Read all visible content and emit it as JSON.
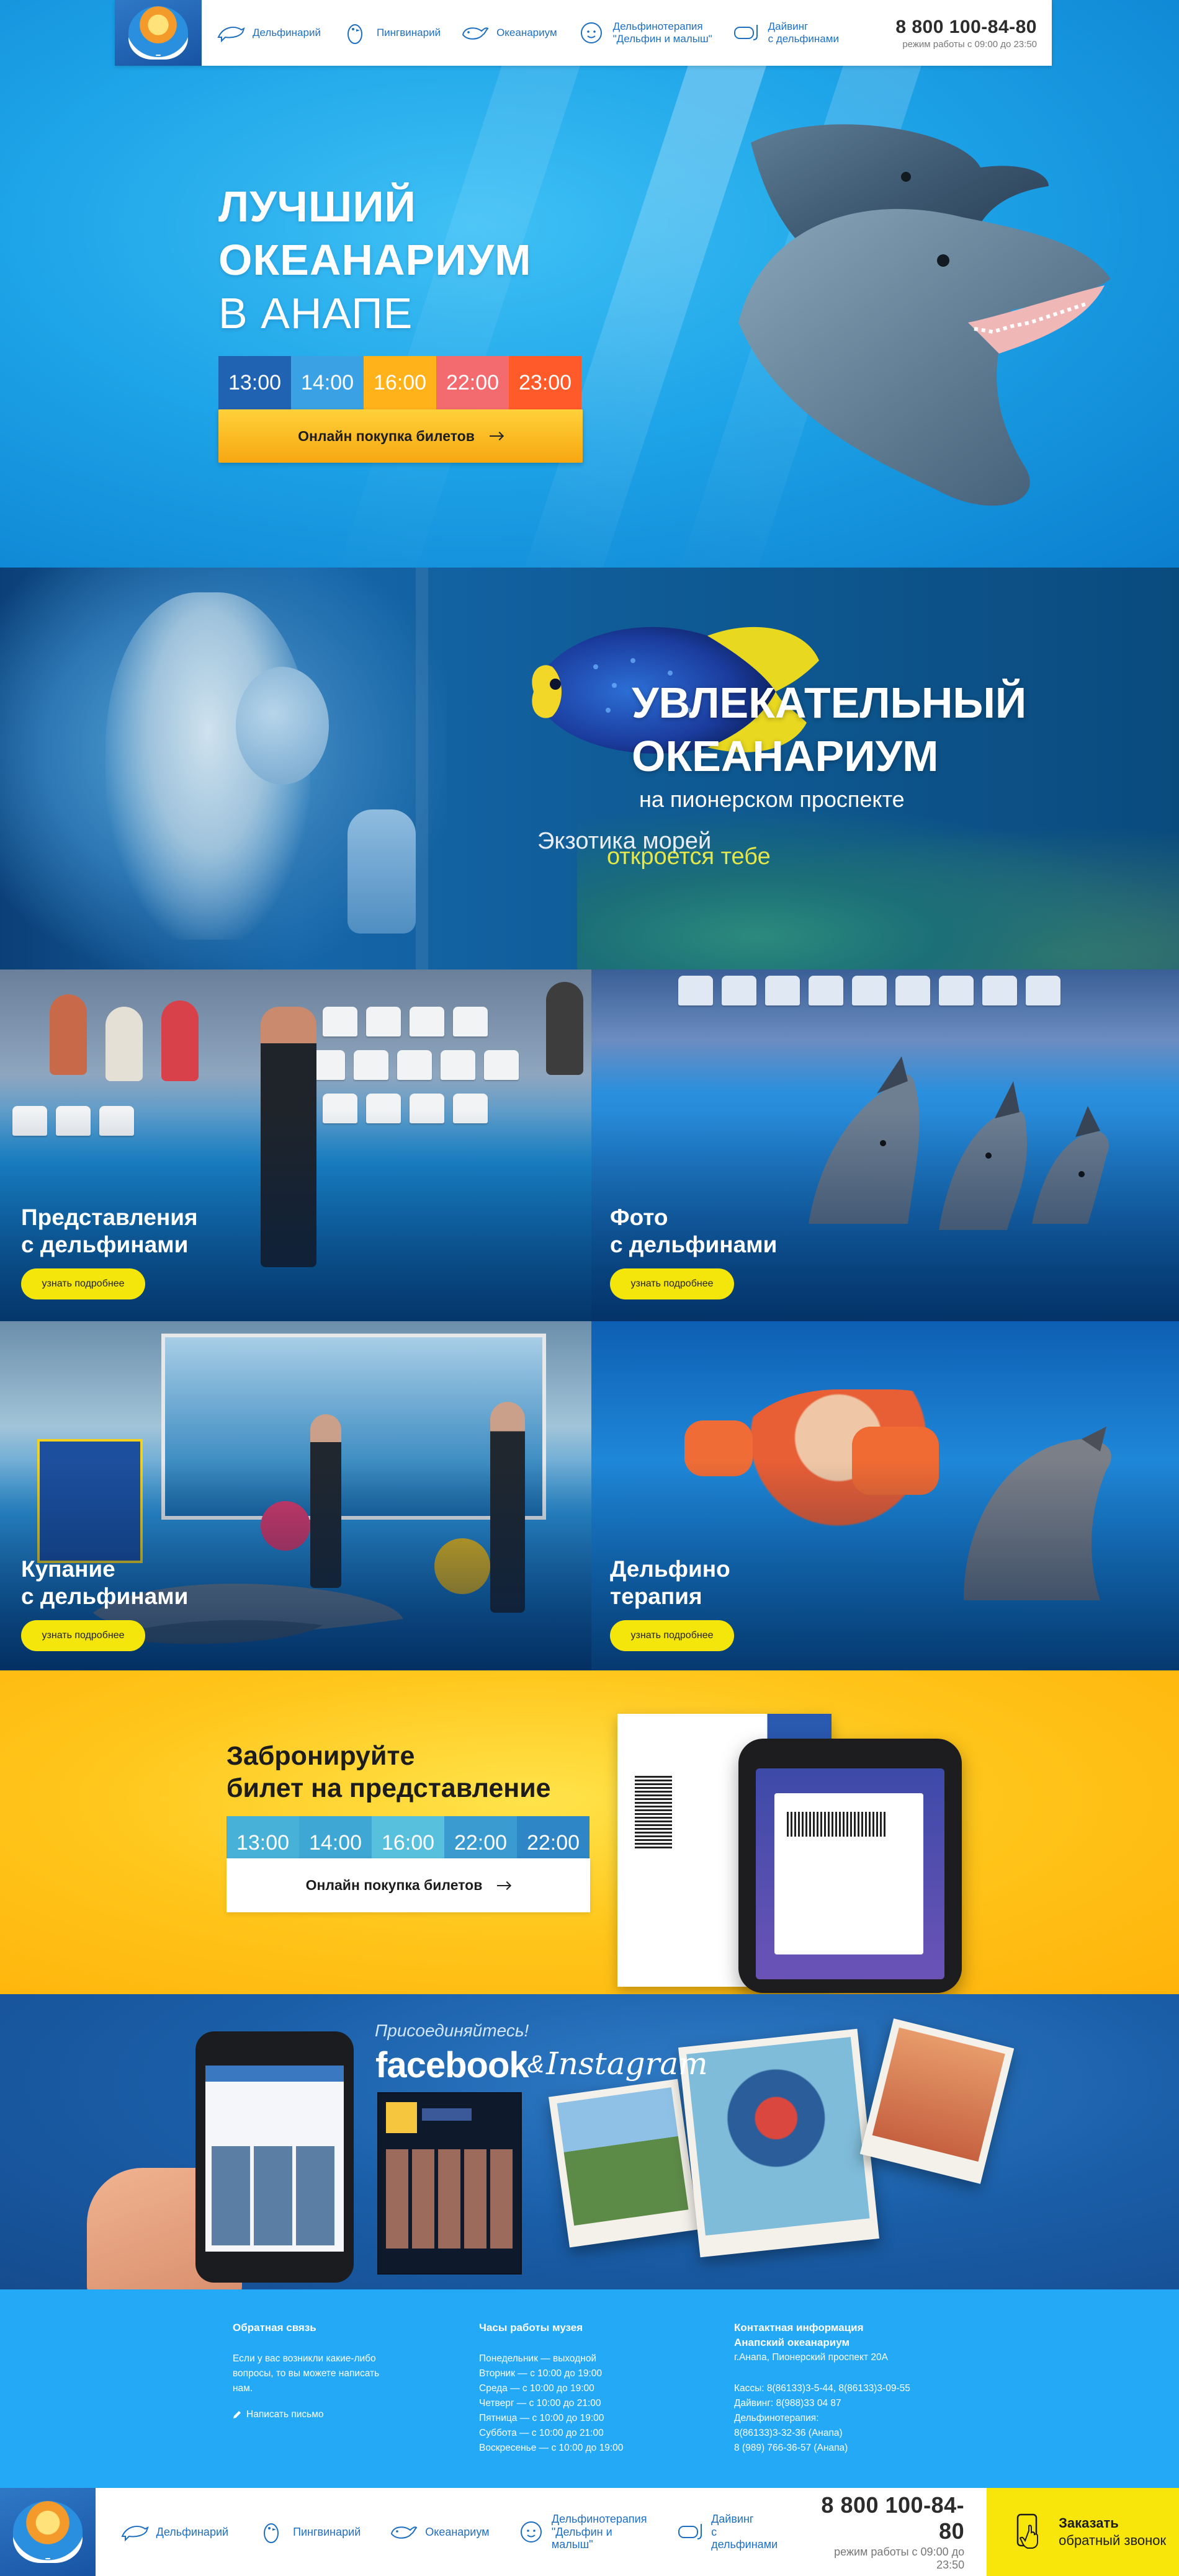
{
  "header": {
    "nav": [
      {
        "label": "Дельфинарий",
        "icon": "dolphin-icon"
      },
      {
        "label": "Пингвинарий",
        "icon": "penguin-icon"
      },
      {
        "label": "Океанариум",
        "icon": "whale-icon"
      },
      {
        "label": "Дельфинотерапия\n\"Дельфин и малыш\"",
        "icon": "baby-icon"
      },
      {
        "label": "Дайвинг\nс дельфинами",
        "icon": "diving-mask-icon"
      }
    ],
    "phone": "8 800 100-84-80",
    "hours": "режим работы с 09:00 до 23:50"
  },
  "hero": {
    "title_line1": "ЛУЧШИЙ",
    "title_line2": "ОКЕАНАРИУМ",
    "title_line3": "В АНАПЕ",
    "times": [
      {
        "label": "13:00",
        "color": "#1f63b2"
      },
      {
        "label": "14:00",
        "color": "#3aa2e4"
      },
      {
        "label": "16:00",
        "color": "#ffb21a"
      },
      {
        "label": "22:00",
        "color": "#f36b6f"
      },
      {
        "label": "23:00",
        "color": "#ff5a2a"
      }
    ],
    "button": "Онлайн покупка билетов"
  },
  "oceanarium": {
    "title_line1": "УВЛЕКАТЕЛЬНЫЙ",
    "title_line2": "ОКЕАНАРИУМ",
    "subtitle": "на пионерском проспекте",
    "tag1": "Экзотика морей",
    "tag2": "откроется тебе"
  },
  "cards": [
    {
      "title_line1": "Представления",
      "title_line2": "с дельфинами",
      "button": "узнать подробнее"
    },
    {
      "title_line1": "Фото",
      "title_line2": "с дельфинами",
      "button": "узнать подробнее"
    },
    {
      "title_line1": "Купание",
      "title_line2": "с дельфинами",
      "button": "узнать подробнее"
    },
    {
      "title_line1": "Дельфино",
      "title_line2": "терапия",
      "button": "узнать подробнее"
    }
  ],
  "booking": {
    "title_line1": "Забронируйте",
    "title_line2": "билет на представление",
    "times": [
      {
        "label": "13:00",
        "color": "#48b1d8"
      },
      {
        "label": "14:00",
        "color": "#3fa7d3"
      },
      {
        "label": "16:00",
        "color": "#57c0dd"
      },
      {
        "label": "22:00",
        "color": "#3a9bd0"
      },
      {
        "label": "22:00",
        "color": "#2f86c6"
      }
    ],
    "button": "Онлайн покупка билетов"
  },
  "social": {
    "join": "Присоединяйтесь!",
    "facebook": "facebook",
    "amp": "&",
    "instagram": "Instagram"
  },
  "footer": {
    "feedback": {
      "title": "Обратная связь",
      "text": "Если у вас возникли какие-либо\nвопросы, то вы можете написать\nнам.",
      "link": "Написать письмо"
    },
    "hours": {
      "title": "Часы работы музея",
      "lines": "Понедельник — выходной\nВторник — с 10:00 до 19:00\nСреда — с 10:00 до 19:00\nЧетверг — с 10:00 до 21:00\nПятница — с 10:00 до 19:00\nСуббота — с 10:00 до 21:00\nВоскресенье — с 10:00 до 19:00"
    },
    "contacts": {
      "title": "Контактная информация\nАнапский океанариум",
      "address": "г.Анапа, Пионерский проспект 20А",
      "lines": "Кассы: 8(86133)3-5-44, 8(86133)3-09-55\nДайвинг: 8(988)33 04 87\nДельфинотерапия:\n8(86133)3-32-36 (Анапа)\n8 (989) 766-36-57 (Анапа)"
    }
  },
  "bottom": {
    "nav": [
      {
        "label": "Дельфинарий",
        "icon": "dolphin-icon"
      },
      {
        "label": "Пингвинарий",
        "icon": "penguin-icon"
      },
      {
        "label": "Океанариум",
        "icon": "whale-icon"
      },
      {
        "label": "Дельфинотерапия\n\"Дельфин и малыш\"",
        "icon": "baby-icon"
      },
      {
        "label": "Дайвинг\nс дельфинами",
        "icon": "diving-mask-icon"
      }
    ],
    "phone": "8 800 100-84-80",
    "hours": "режим работы с 09:00 до 23:50",
    "callback_title": "Заказать",
    "callback_sub": "обратный звонок"
  },
  "colors": {
    "brand_blue": "#1f6fc1",
    "accent_yellow": "#f4e50a",
    "footer_blue": "#24a9f6"
  }
}
